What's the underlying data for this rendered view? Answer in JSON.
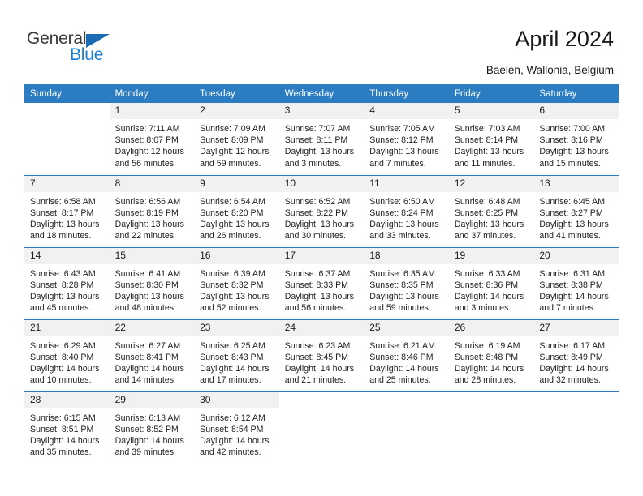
{
  "brand": {
    "name_part1": "General",
    "name_part2": "Blue",
    "triangle_icon": "triangle-icon",
    "primary_color": "#1b6cb5",
    "accent_color": "#1b7fd4"
  },
  "header": {
    "title": "April 2024",
    "location": "Baelen, Wallonia, Belgium"
  },
  "theme": {
    "header_bg": "#2b7cc0",
    "header_text": "#ffffff",
    "daynum_bg": "#f1f1f1",
    "cell_bg": "#ffffff",
    "separator": "#2b7cc0"
  },
  "weekdays": [
    "Sunday",
    "Monday",
    "Tuesday",
    "Wednesday",
    "Thursday",
    "Friday",
    "Saturday"
  ],
  "weeks": [
    [
      {
        "day": ""
      },
      {
        "day": "1",
        "sunrise": "Sunrise: 7:11 AM",
        "sunset": "Sunset: 8:07 PM",
        "daylight": "Daylight: 12 hours and 56 minutes."
      },
      {
        "day": "2",
        "sunrise": "Sunrise: 7:09 AM",
        "sunset": "Sunset: 8:09 PM",
        "daylight": "Daylight: 12 hours and 59 minutes."
      },
      {
        "day": "3",
        "sunrise": "Sunrise: 7:07 AM",
        "sunset": "Sunset: 8:11 PM",
        "daylight": "Daylight: 13 hours and 3 minutes."
      },
      {
        "day": "4",
        "sunrise": "Sunrise: 7:05 AM",
        "sunset": "Sunset: 8:12 PM",
        "daylight": "Daylight: 13 hours and 7 minutes."
      },
      {
        "day": "5",
        "sunrise": "Sunrise: 7:03 AM",
        "sunset": "Sunset: 8:14 PM",
        "daylight": "Daylight: 13 hours and 11 minutes."
      },
      {
        "day": "6",
        "sunrise": "Sunrise: 7:00 AM",
        "sunset": "Sunset: 8:16 PM",
        "daylight": "Daylight: 13 hours and 15 minutes."
      }
    ],
    [
      {
        "day": "7",
        "sunrise": "Sunrise: 6:58 AM",
        "sunset": "Sunset: 8:17 PM",
        "daylight": "Daylight: 13 hours and 18 minutes."
      },
      {
        "day": "8",
        "sunrise": "Sunrise: 6:56 AM",
        "sunset": "Sunset: 8:19 PM",
        "daylight": "Daylight: 13 hours and 22 minutes."
      },
      {
        "day": "9",
        "sunrise": "Sunrise: 6:54 AM",
        "sunset": "Sunset: 8:20 PM",
        "daylight": "Daylight: 13 hours and 26 minutes."
      },
      {
        "day": "10",
        "sunrise": "Sunrise: 6:52 AM",
        "sunset": "Sunset: 8:22 PM",
        "daylight": "Daylight: 13 hours and 30 minutes."
      },
      {
        "day": "11",
        "sunrise": "Sunrise: 6:50 AM",
        "sunset": "Sunset: 8:24 PM",
        "daylight": "Daylight: 13 hours and 33 minutes."
      },
      {
        "day": "12",
        "sunrise": "Sunrise: 6:48 AM",
        "sunset": "Sunset: 8:25 PM",
        "daylight": "Daylight: 13 hours and 37 minutes."
      },
      {
        "day": "13",
        "sunrise": "Sunrise: 6:45 AM",
        "sunset": "Sunset: 8:27 PM",
        "daylight": "Daylight: 13 hours and 41 minutes."
      }
    ],
    [
      {
        "day": "14",
        "sunrise": "Sunrise: 6:43 AM",
        "sunset": "Sunset: 8:28 PM",
        "daylight": "Daylight: 13 hours and 45 minutes."
      },
      {
        "day": "15",
        "sunrise": "Sunrise: 6:41 AM",
        "sunset": "Sunset: 8:30 PM",
        "daylight": "Daylight: 13 hours and 48 minutes."
      },
      {
        "day": "16",
        "sunrise": "Sunrise: 6:39 AM",
        "sunset": "Sunset: 8:32 PM",
        "daylight": "Daylight: 13 hours and 52 minutes."
      },
      {
        "day": "17",
        "sunrise": "Sunrise: 6:37 AM",
        "sunset": "Sunset: 8:33 PM",
        "daylight": "Daylight: 13 hours and 56 minutes."
      },
      {
        "day": "18",
        "sunrise": "Sunrise: 6:35 AM",
        "sunset": "Sunset: 8:35 PM",
        "daylight": "Daylight: 13 hours and 59 minutes."
      },
      {
        "day": "19",
        "sunrise": "Sunrise: 6:33 AM",
        "sunset": "Sunset: 8:36 PM",
        "daylight": "Daylight: 14 hours and 3 minutes."
      },
      {
        "day": "20",
        "sunrise": "Sunrise: 6:31 AM",
        "sunset": "Sunset: 8:38 PM",
        "daylight": "Daylight: 14 hours and 7 minutes."
      }
    ],
    [
      {
        "day": "21",
        "sunrise": "Sunrise: 6:29 AM",
        "sunset": "Sunset: 8:40 PM",
        "daylight": "Daylight: 14 hours and 10 minutes."
      },
      {
        "day": "22",
        "sunrise": "Sunrise: 6:27 AM",
        "sunset": "Sunset: 8:41 PM",
        "daylight": "Daylight: 14 hours and 14 minutes."
      },
      {
        "day": "23",
        "sunrise": "Sunrise: 6:25 AM",
        "sunset": "Sunset: 8:43 PM",
        "daylight": "Daylight: 14 hours and 17 minutes."
      },
      {
        "day": "24",
        "sunrise": "Sunrise: 6:23 AM",
        "sunset": "Sunset: 8:45 PM",
        "daylight": "Daylight: 14 hours and 21 minutes."
      },
      {
        "day": "25",
        "sunrise": "Sunrise: 6:21 AM",
        "sunset": "Sunset: 8:46 PM",
        "daylight": "Daylight: 14 hours and 25 minutes."
      },
      {
        "day": "26",
        "sunrise": "Sunrise: 6:19 AM",
        "sunset": "Sunset: 8:48 PM",
        "daylight": "Daylight: 14 hours and 28 minutes."
      },
      {
        "day": "27",
        "sunrise": "Sunrise: 6:17 AM",
        "sunset": "Sunset: 8:49 PM",
        "daylight": "Daylight: 14 hours and 32 minutes."
      }
    ],
    [
      {
        "day": "28",
        "sunrise": "Sunrise: 6:15 AM",
        "sunset": "Sunset: 8:51 PM",
        "daylight": "Daylight: 14 hours and 35 minutes."
      },
      {
        "day": "29",
        "sunrise": "Sunrise: 6:13 AM",
        "sunset": "Sunset: 8:52 PM",
        "daylight": "Daylight: 14 hours and 39 minutes."
      },
      {
        "day": "30",
        "sunrise": "Sunrise: 6:12 AM",
        "sunset": "Sunset: 8:54 PM",
        "daylight": "Daylight: 14 hours and 42 minutes."
      },
      {
        "day": ""
      },
      {
        "day": ""
      },
      {
        "day": ""
      },
      {
        "day": ""
      }
    ]
  ]
}
